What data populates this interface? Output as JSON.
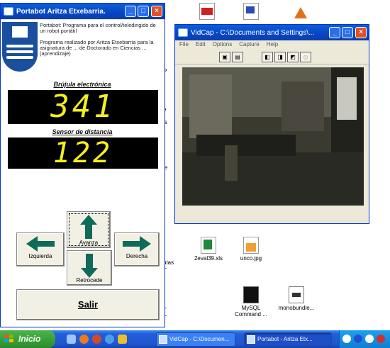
{
  "desktop_icons": [
    {
      "id": "excel",
      "label": "2eval39.xls"
    },
    {
      "id": "jpg",
      "label": "unco.jpg"
    },
    {
      "id": "mysql",
      "label": "MySQL Command ..."
    },
    {
      "id": "monobundle",
      "label": "monobundle..."
    }
  ],
  "desktop_edge_labels": [
    "P",
    "r",
    "e",
    "is",
    "le",
    "ntas",
    "T",
    "T",
    "T"
  ],
  "portabot": {
    "title": "Portabot   Aritza Etxebarria.",
    "description_1": "Portabot: Programa para el control/teledirigido de un robot portátil",
    "description_2": "Programa realizado por Aritza Etxebarria para la asignatura de ... de Doctorado en Ciencias ... (aprendizaje)",
    "compass_label": "Brújula electrónica",
    "compass_value": "341",
    "distance_label": "Sensor de distancia",
    "distance_value": "122",
    "btn_forward": "Avanza",
    "btn_left": "Izquierda",
    "btn_right": "Derecha",
    "btn_back": "Retrocede",
    "btn_exit": "Salir"
  },
  "vidcap": {
    "title": "VidCap - C:\\Documents and Settings\\...",
    "menu": [
      "File",
      "Edit",
      "Options",
      "Capture",
      "Help"
    ]
  },
  "taskbar": {
    "start": "Inicio",
    "tasks": [
      {
        "label": "VidCap - C:\\Documen...",
        "active": false
      },
      {
        "label": "Portabot - Aritza Etx...",
        "active": true
      }
    ]
  },
  "colors": {
    "led_text": "#f4ef1e",
    "arrow": "#0f6a5a",
    "title_blue": "#0845c4",
    "taskbar_green": "#37a337"
  }
}
